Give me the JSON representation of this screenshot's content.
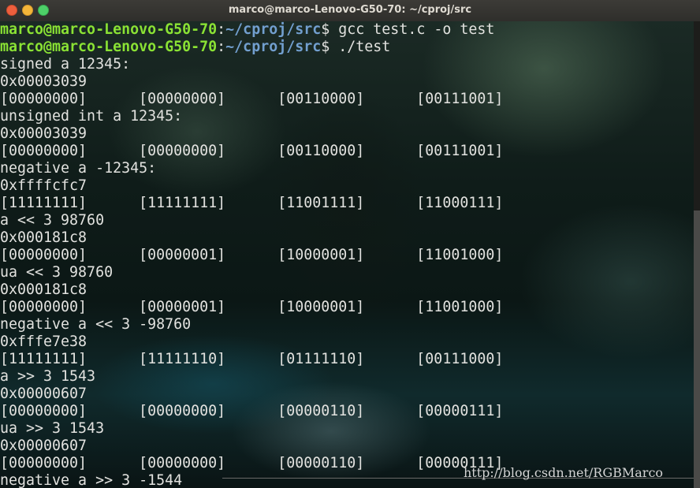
{
  "window": {
    "title": "marco@marco-Lenovo-G50-70: ~/cproj/src"
  },
  "colors": {
    "prompt_user": "#8ae234",
    "prompt_path": "#729fcf",
    "text": "#e2e2df"
  },
  "terminal": {
    "prompts": [
      {
        "user": "marco@marco-Lenovo-G50-70",
        "sep": ":",
        "path": "~/cproj/src",
        "sym": "$",
        "cmd": " gcc test.c -o test"
      },
      {
        "user": "marco@marco-Lenovo-G50-70",
        "sep": ":",
        "path": "~/cproj/src",
        "sym": "$",
        "cmd": " ./test"
      }
    ],
    "output": [
      "signed a 12345:",
      "0x00003039",
      "[00000000]      [00000000]      [00110000]      [00111001]",
      "unsigned int a 12345:",
      "0x00003039",
      "[00000000]      [00000000]      [00110000]      [00111001]",
      "negative a -12345:",
      "0xffffcfc7",
      "[11111111]      [11111111]      [11001111]      [11000111]",
      "a << 3 98760",
      "0x000181c8",
      "[00000000]      [00000001]      [10000001]      [11001000]",
      "ua << 3 98760",
      "0x000181c8",
      "[00000000]      [00000001]      [10000001]      [11001000]",
      "negative a << 3 -98760",
      "0xfffe7e38",
      "[11111111]      [11111110]      [01111110]      [00111000]",
      "a >> 3 1543",
      "0x00000607",
      "[00000000]      [00000000]      [00000110]      [00000111]",
      "ua >> 3 1543",
      "0x00000607",
      "[00000000]      [00000000]      [00000110]      [00000111]",
      "negative a >> 3 -1544"
    ],
    "watermark": "http://blog.csdn.net/RGBMarco"
  }
}
